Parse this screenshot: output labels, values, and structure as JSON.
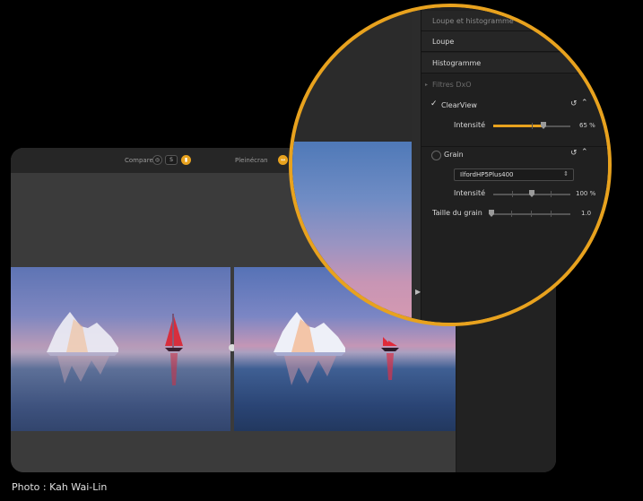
{
  "topbar": {
    "compare_label": "Comparer",
    "split_label": "S",
    "before_after_label": "Pleinécran",
    "before_after_badge": "↔"
  },
  "panel": {
    "section_top_partial": "Loupe et histogramme",
    "loupe_label": "Loupe",
    "histogram_label": "Histogramme",
    "filters_header": "Filtres DxO",
    "clearview": {
      "label": "ClearView",
      "checked": true,
      "intensity_label": "Intensité",
      "intensity_value": "65 %",
      "intensity_level": 0.65
    },
    "grain": {
      "label": "Grain",
      "checked": false,
      "film_option": "IlfordHP5Plus400",
      "intensity_label": "Intensité",
      "intensity_value": "100 %",
      "intensity_level": 0.5,
      "size_label": "Taille du grain",
      "size_value": "1.0",
      "size_level": 0.0
    }
  },
  "colors": {
    "accent": "#e8a21e",
    "panel_bg": "#202020",
    "window_bg": "#3a3a3a"
  },
  "credit": "Photo : Kah Wai-Lin"
}
